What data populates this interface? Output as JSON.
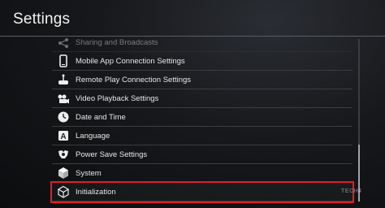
{
  "header": {
    "title": "Settings"
  },
  "menu": {
    "items": [
      {
        "label": "Sharing and Broadcasts",
        "icon": "share-icon"
      },
      {
        "label": "Mobile App Connection Settings",
        "icon": "phone-icon"
      },
      {
        "label": "Remote Play Connection Settings",
        "icon": "remote-play-icon"
      },
      {
        "label": "Video Playback Settings",
        "icon": "video-playback-icon"
      },
      {
        "label": "Date and Time",
        "icon": "clock-icon"
      },
      {
        "label": "Language",
        "icon": "language-icon"
      },
      {
        "label": "Power Save Settings",
        "icon": "power-save-icon"
      },
      {
        "label": "System",
        "icon": "system-cube-icon"
      },
      {
        "label": "Initialization",
        "icon": "initialization-icon"
      }
    ],
    "selected_index": 8
  },
  "watermark": {
    "text": "TECH4"
  },
  "colors": {
    "highlight": "#e02020",
    "text": "#e6e6e6"
  }
}
